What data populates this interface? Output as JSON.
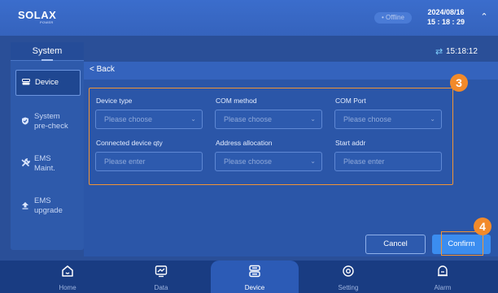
{
  "header": {
    "logo_text": "SOLAX",
    "logo_sub": "POWER",
    "status": "• Offline",
    "date": "2024/08/16",
    "time": "15 : 18 : 29",
    "collapse_icon": "chevron-up-icon"
  },
  "sidebar": {
    "title": "System",
    "items": [
      {
        "label": "Device",
        "icon": "device-icon"
      },
      {
        "label_line1": "System",
        "label_line2": "pre-check",
        "icon": "shield-check-icon"
      },
      {
        "label_line1": "EMS",
        "label_line2": "Maint.",
        "icon": "wrench-icon"
      },
      {
        "label_line1": "EMS",
        "label_line2": "upgrade",
        "icon": "upload-icon"
      }
    ]
  },
  "content": {
    "sync_time": "15:18:12",
    "back_label": "< Back",
    "form": {
      "device_type": {
        "label": "Device type",
        "placeholder": "Please choose"
      },
      "com_method": {
        "label": "COM method",
        "placeholder": "Please choose"
      },
      "com_port": {
        "label": "COM Port",
        "placeholder": "Please choose"
      },
      "device_qty": {
        "label": "Connected device qty",
        "placeholder": "Please enter"
      },
      "address_allocation": {
        "label": "Address allocation",
        "placeholder": "Please choose"
      },
      "start_addr": {
        "label": "Start addr",
        "placeholder": "Please enter"
      }
    },
    "cancel_label": "Cancel",
    "confirm_label": "Confirm",
    "callout_3": "3",
    "callout_4": "4"
  },
  "bottom_nav": [
    {
      "label": "Home",
      "icon": "home-icon"
    },
    {
      "label": "Data",
      "icon": "chart-icon"
    },
    {
      "label": "Device",
      "icon": "device-icon"
    },
    {
      "label": "Setting",
      "icon": "settings-icon"
    },
    {
      "label": "Alarm",
      "icon": "alarm-icon"
    }
  ],
  "colors": {
    "accent": "#3b8df0",
    "callout": "#f28a2a",
    "background": "#2a4f98"
  }
}
